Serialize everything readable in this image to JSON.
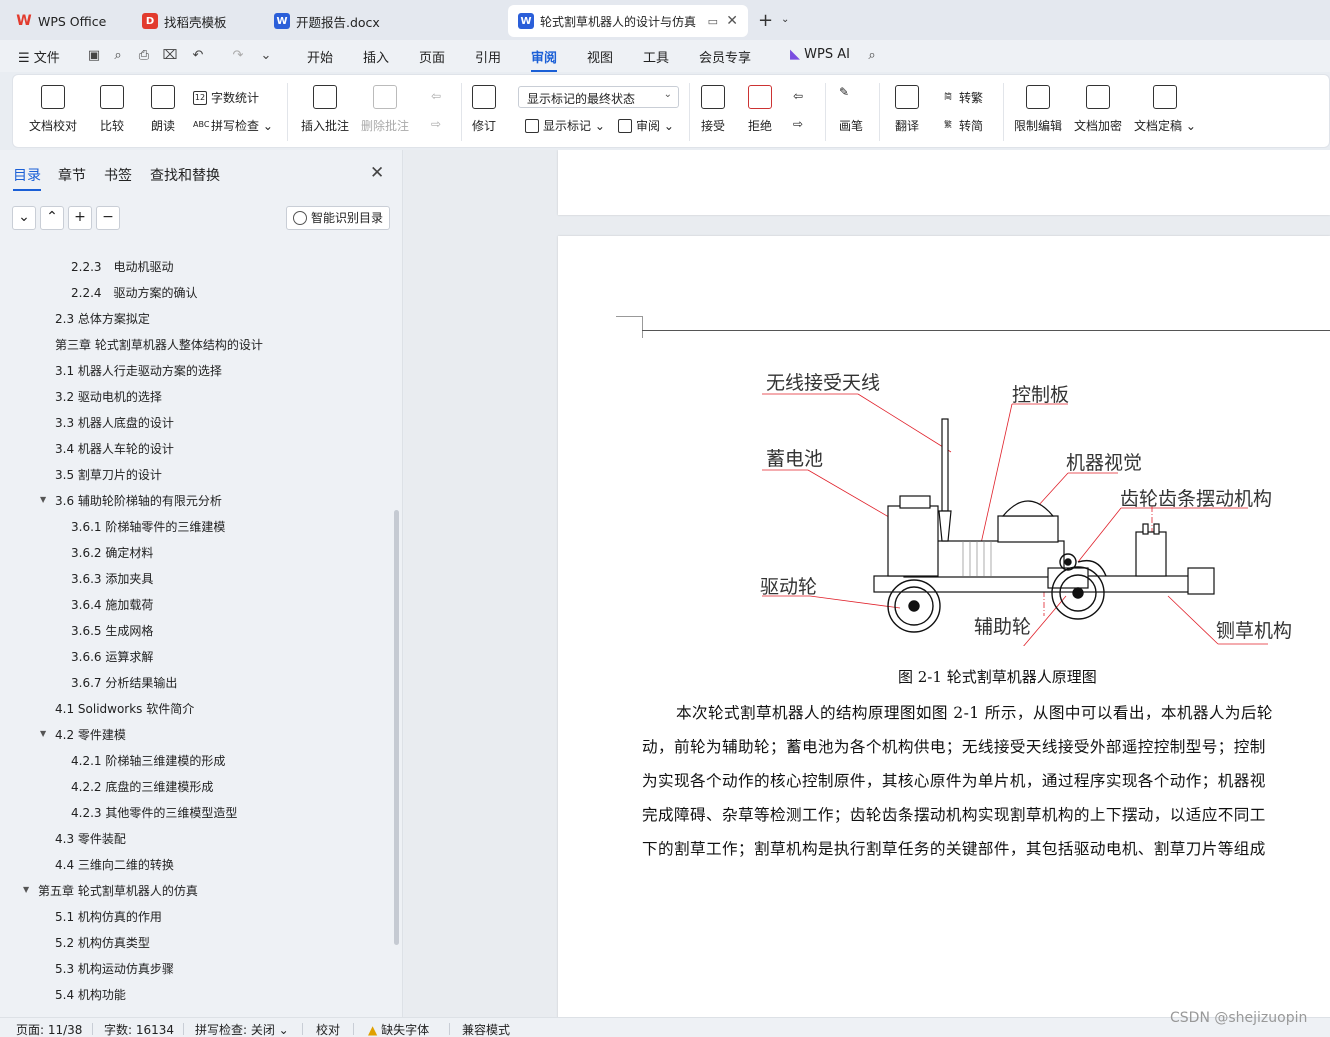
{
  "tabs": [
    {
      "label": "WPS Office",
      "icon": "wps-logo-icon",
      "color": "#e23b2e"
    },
    {
      "label": "找稻壳模板",
      "icon": "docer-icon",
      "color": "#e23b2e"
    },
    {
      "label": "开题报告.docx",
      "icon": "word-doc-icon",
      "color": "#2b5fd9"
    },
    {
      "label": "轮式割草机器人的设计与仿真",
      "icon": "word-doc-icon",
      "color": "#2b5fd9",
      "active": true
    }
  ],
  "menubar": {
    "file": "文件",
    "items": [
      "开始",
      "插入",
      "页面",
      "引用",
      "审阅",
      "视图",
      "工具",
      "会员专享"
    ],
    "active": "审阅",
    "wps_ai": "WPS AI"
  },
  "ribbon": {
    "doc_check": "文档校对",
    "compare": "比较",
    "read_aloud": "朗读",
    "word_count": "字数统计",
    "spell_check": "拼写检查",
    "insert_comment": "插入批注",
    "delete_comment": "删除批注",
    "revise": "修订",
    "display_mode": "显示标记的最终状态",
    "show_markup": "显示标记",
    "review": "审阅",
    "accept": "接受",
    "reject": "拒绝",
    "pen": "画笔",
    "translate": "翻译",
    "to_traditional": "转繁",
    "to_simplified": "转简",
    "restrict_edit": "限制编辑",
    "encrypt": "文档加密",
    "finalize": "文档定稿"
  },
  "sidebar": {
    "tabs": [
      "目录",
      "章节",
      "书签",
      "查找和替换"
    ],
    "active_tab": "目录",
    "smart_toc": "智能识别目录",
    "toc": [
      {
        "label": "2.2.3　电动机驱动",
        "level": 3
      },
      {
        "label": "2.2.4　驱动方案的确认",
        "level": 3
      },
      {
        "label": "2.3  总体方案拟定",
        "level": 2
      },
      {
        "label": "第三章  轮式割草机器人整体结构的设计",
        "level": 2
      },
      {
        "label": "3.1 机器人行走驱动方案的选择",
        "level": 2
      },
      {
        "label": "3.2 驱动电机的选择",
        "level": 2
      },
      {
        "label": "3.3 机器人底盘的设计",
        "level": 2
      },
      {
        "label": "3.4  机器人车轮的设计",
        "level": 2
      },
      {
        "label": "3.5 割草刀片的设计",
        "level": 2
      },
      {
        "label": "3.6  辅助轮阶梯轴的有限元分析",
        "level": 2,
        "expanded": true
      },
      {
        "label": "3.6.1  阶梯轴零件的三维建模",
        "level": 3
      },
      {
        "label": "3.6.2  确定材料",
        "level": 3
      },
      {
        "label": "3.6.3  添加夹具",
        "level": 3
      },
      {
        "label": "3.6.4  施加载荷",
        "level": 3
      },
      {
        "label": "3.6.5  生成网格",
        "level": 3
      },
      {
        "label": "3.6.6  运算求解",
        "level": 3
      },
      {
        "label": "3.6.7  分析结果输出",
        "level": 3
      },
      {
        "label": "4.1 Solidworks 软件简介",
        "level": 2
      },
      {
        "label": "4.2  零件建模",
        "level": 2,
        "expanded": true
      },
      {
        "label": "4.2.1 阶梯轴三维建模的形成",
        "level": 3
      },
      {
        "label": "4.2.2  底盘的三维建模形成",
        "level": 3
      },
      {
        "label": "4.2.3 其他零件的三维模型造型",
        "level": 3
      },
      {
        "label": "4.3 零件装配",
        "level": 2
      },
      {
        "label": "4.4 三维向二维的转换",
        "level": 2
      },
      {
        "label": "第五章  轮式割草机器人的仿真",
        "level": 1,
        "expanded": true
      },
      {
        "label": "5.1 机构仿真的作用",
        "level": 2
      },
      {
        "label": "5.2 机构仿真类型",
        "level": 2
      },
      {
        "label": "5.3 机构运动仿真步骤",
        "level": 2
      },
      {
        "label": "5.4  机构功能",
        "level": 2
      }
    ]
  },
  "figure": {
    "labels": [
      "无线接受天线",
      "控制板",
      "蓄电池",
      "机器视觉",
      "齿轮齿条摆动机构",
      "驱动轮",
      "辅助轮",
      "铡草机构"
    ],
    "caption": "图 2-1  轮式割草机器人原理图"
  },
  "paragraph": [
    "本次轮式割草机器人的结构原理图如图 2-1 所示，从图中可以看出，本机器人为后轮",
    "动，前轮为辅助轮；蓄电池为各个机构供电；无线接受天线接受外部遥控控制型号；控制",
    "为实现各个动作的核心控制原件，其核心原件为单片机，通过程序实现各个动作；机器视",
    "完成障碍、杂草等检测工作；齿轮齿条摆动机构实现割草机构的上下摆动，以适应不同工",
    "下的割草工作；割草机构是执行割草任务的关键部件，其包括驱动电机、割草刀片等组成"
  ],
  "status": {
    "page": "页面: 11/38",
    "words": "字数: 16134",
    "spell": "拼写检查: 关闭",
    "proof": "校对",
    "missing_font": "缺失字体",
    "compat": "兼容模式"
  },
  "watermark": "CSDN @shejizuopin"
}
